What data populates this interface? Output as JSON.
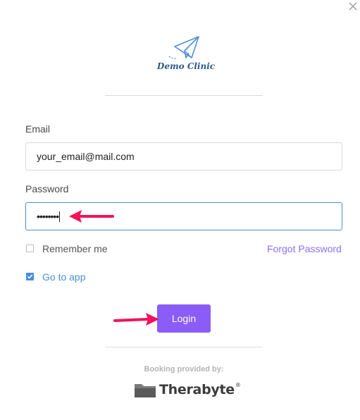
{
  "dialog": {
    "close_icon": "close-icon"
  },
  "logo": {
    "icon": "paper-plane-icon",
    "text": "Demo Clinic"
  },
  "form": {
    "email_label": "Email",
    "email_value": "your_email@mail.com",
    "password_label": "Password",
    "password_value": "••••••••",
    "remember_me_label": "Remember me",
    "remember_me_checked": false,
    "forgot_password_label": "Forgot Password",
    "go_to_app_label": "Go to app",
    "go_to_app_checked": true,
    "login_label": "Login"
  },
  "footer": {
    "caption": "Booking provided by:",
    "brand": "Therabyte",
    "brand_mark": "®"
  },
  "annotations": {
    "arrow_color": "#f0145a",
    "arrows": [
      "pointing-to-password-field",
      "pointing-to-login-button"
    ]
  },
  "colors": {
    "accent": "#8b5cf6",
    "link": "#8e6ff7",
    "checkbox_checked": "#4a90d9",
    "focus_border": "#4c8fc4",
    "logo_blue": "#4a90d9"
  }
}
